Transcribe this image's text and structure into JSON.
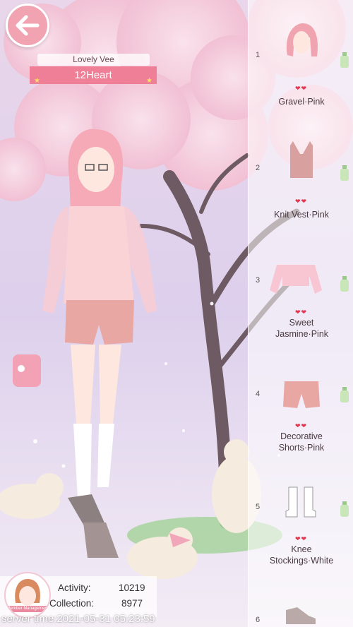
{
  "player": {
    "name": "Lovely Vee",
    "title": "12Heart"
  },
  "items": [
    {
      "num": "1",
      "name": "Gravel·Pink",
      "hearts": "❤❤",
      "icon": "hair-icon"
    },
    {
      "num": "2",
      "name": "Knit Vest·Pink",
      "hearts": "❤❤",
      "icon": "knit-vest-icon"
    },
    {
      "num": "3",
      "name": "Sweet Jasmine·Pink",
      "hearts": "❤❤",
      "icon": "blouse-icon"
    },
    {
      "num": "4",
      "name": "Decorative Shorts·Pink",
      "hearts": "❤❤",
      "icon": "shorts-icon"
    },
    {
      "num": "5",
      "name": "Knee Stockings·White",
      "hearts": "❤❤",
      "icon": "stockings-icon"
    },
    {
      "num": "6",
      "name": "",
      "hearts": "",
      "icon": "shoes-icon"
    }
  ],
  "stats": {
    "activity_label": "Activity:",
    "activity_value": "10219",
    "collection_label": "Collection:",
    "collection_value": "8977"
  },
  "avatar": {
    "caption": "Member Management"
  },
  "server": {
    "text": "server time:2021-05-31 05:23:59"
  },
  "colors": {
    "accent": "#ee7f96",
    "heart": "#e4364f",
    "star": "#ffe066"
  }
}
